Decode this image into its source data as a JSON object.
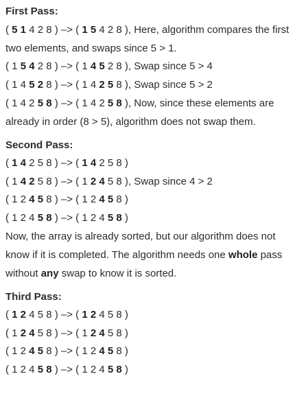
{
  "sections": [
    {
      "title": "First Pass:",
      "lines": [
        [
          {
            "t": "( "
          },
          {
            "t": "5 1",
            "b": true
          },
          {
            "t": " 4 2 8 ) –> ( "
          },
          {
            "t": "1 5",
            "b": true
          },
          {
            "t": " 4 2 8 ), Here, algorithm compares the first two elements, and swaps since 5 > 1."
          }
        ],
        [
          {
            "t": "( 1 "
          },
          {
            "t": "5 4",
            "b": true
          },
          {
            "t": " 2 8 ) –>  ( 1 "
          },
          {
            "t": "4 5",
            "b": true
          },
          {
            "t": " 2 8 ), Swap since 5 > 4"
          }
        ],
        [
          {
            "t": "( 1 4 "
          },
          {
            "t": "5 2",
            "b": true
          },
          {
            "t": " 8 ) –>  ( 1 4 "
          },
          {
            "t": "2 5",
            "b": true
          },
          {
            "t": " 8 ), Swap since 5 > 2"
          }
        ],
        [
          {
            "t": "( 1 4 2 "
          },
          {
            "t": "5 8",
            "b": true
          },
          {
            "t": " ) –> ( 1 4 2 "
          },
          {
            "t": "5 8",
            "b": true
          },
          {
            "t": " ), Now, since these elements are already in order (8 > 5), algorithm does not swap them."
          }
        ]
      ]
    },
    {
      "title": "Second Pass:",
      "lines": [
        [
          {
            "t": "( "
          },
          {
            "t": "1 4",
            "b": true
          },
          {
            "t": " 2 5 8 ) –> ( "
          },
          {
            "t": "1 4",
            "b": true
          },
          {
            "t": " 2 5 8 )"
          }
        ],
        [
          {
            "t": "( 1 "
          },
          {
            "t": "4 2",
            "b": true
          },
          {
            "t": " 5 8 ) –> ( 1 "
          },
          {
            "t": "2 4",
            "b": true
          },
          {
            "t": " 5 8 ), Swap since 4 > 2"
          }
        ],
        [
          {
            "t": "( 1 2 "
          },
          {
            "t": "4 5",
            "b": true
          },
          {
            "t": " 8 ) –> ( 1 2 "
          },
          {
            "t": "4 5",
            "b": true
          },
          {
            "t": " 8 )"
          }
        ],
        [
          {
            "t": "( 1 2 4 "
          },
          {
            "t": "5 8",
            "b": true
          },
          {
            "t": " ) –>  ( 1 2 4 "
          },
          {
            "t": "5 8",
            "b": true
          },
          {
            "t": " )"
          }
        ],
        [
          {
            "t": "Now, the array is already sorted, but our algorithm does not know if it is completed. The algorithm needs one "
          },
          {
            "t": "whole",
            "b": true
          },
          {
            "t": " pass without "
          },
          {
            "t": "any",
            "b": true
          },
          {
            "t": " swap to know it is sorted."
          }
        ]
      ]
    },
    {
      "title": "Third Pass:",
      "lines": [
        [
          {
            "t": "( "
          },
          {
            "t": "1 2",
            "b": true
          },
          {
            "t": " 4 5 8 ) –> ( "
          },
          {
            "t": "1 2",
            "b": true
          },
          {
            "t": " 4 5 8 )"
          }
        ],
        [
          {
            "t": "( 1 "
          },
          {
            "t": "2 4",
            "b": true
          },
          {
            "t": " 5 8 ) –> ( 1 "
          },
          {
            "t": "2 4",
            "b": true
          },
          {
            "t": " 5 8 )"
          }
        ],
        [
          {
            "t": "( 1 2 "
          },
          {
            "t": "4 5",
            "b": true
          },
          {
            "t": " 8 ) –> ( 1 2 "
          },
          {
            "t": "4 5",
            "b": true
          },
          {
            "t": " 8 )"
          }
        ],
        [
          {
            "t": "( 1 2 4 "
          },
          {
            "t": "5 8",
            "b": true
          },
          {
            "t": " ) –> ( 1 2 4 "
          },
          {
            "t": "5 8",
            "b": true
          },
          {
            "t": " )"
          }
        ]
      ]
    }
  ]
}
